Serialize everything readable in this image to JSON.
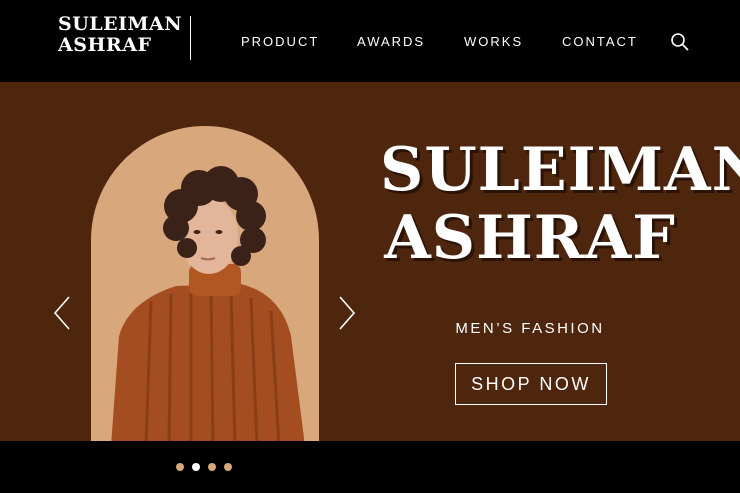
{
  "brand": {
    "line1": "SULEIMAN",
    "line2": "ASHRAF"
  },
  "nav": {
    "items": [
      "PRODUCT",
      "AWARDS",
      "WORKS",
      "CONTACT"
    ]
  },
  "hero": {
    "title_line1": "SULEIMAN",
    "title_line2": "ASHRAF",
    "subtitle": "MEN’S FASHION",
    "cta": "SHOP NOW"
  },
  "carousel": {
    "slide_count": 4,
    "active_index": 1
  },
  "colors": {
    "header_bg": "#000000",
    "hero_bg": "#4e250d",
    "arch_bg": "#d9a77c",
    "dot_inactive": "#d9a77c",
    "dot_active": "#ffffff"
  }
}
